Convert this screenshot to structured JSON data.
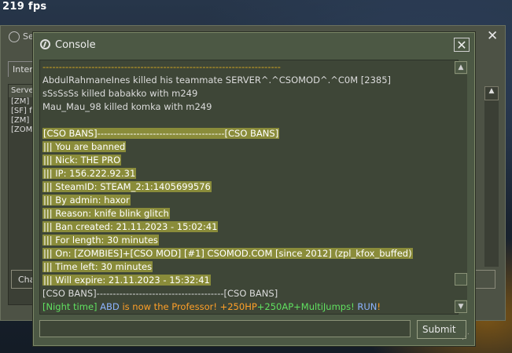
{
  "hud": {
    "fps": "219 fps"
  },
  "bg_window": {
    "title": "Se",
    "close": "✕",
    "tab": "Intern",
    "list_header": "Serve",
    "rows": [
      "[ZM]",
      "[SF] f",
      "[ZM]",
      "[ZOM"
    ],
    "left_button": "Cha",
    "right_button": "t"
  },
  "console": {
    "title": "Console",
    "close": "✕",
    "lines": [
      "-------------------------------------------------------------------------",
      "AbdulRahmaneInes killed his teammate SERVER^.^CSOMOD^.^C0M [2385]",
      "sSsSsSs killed babakko with m249",
      "Mau_Mau_98 killed komka with m249",
      "",
      "[CSO BANS]---------------------------------------[CSO BANS]",
      "||| You are banned",
      "||| Nick: THE PRO",
      "||| IP: 156.222.92.31",
      "||| SteamID: STEAM_2:1:1405699576",
      "||| By admin: haxor",
      "||| Reason: knife blink glitch",
      "||| Ban created: 21.11.2023 - 15:02:41",
      "||| For length: 30 minutes",
      "||| On: [ZOMBIES]+[CSO MOD] [#1] CSOMOD.COM [since 2012] (zpl_kfox_buffed)",
      "||| Time left: 30 minutes",
      "||| Will expire: 21.11.2023 - 15:32:41",
      "[CSO BANS]---------------------------------------[CSO BANS]"
    ],
    "colored_line": {
      "p1": "[Night time] ",
      "p2": "ABD",
      "p3": " is now the ",
      "p4": "Professor!",
      "p5": " +250HP",
      "p6": "+250AP",
      "p7": "+MultiJumps!",
      "p8": " RUN",
      "p9": "!"
    },
    "input_value": "",
    "submit_label": "Submit",
    "scroll_up": "▲",
    "scroll_down": "▼",
    "resize_grip": "⋰"
  }
}
